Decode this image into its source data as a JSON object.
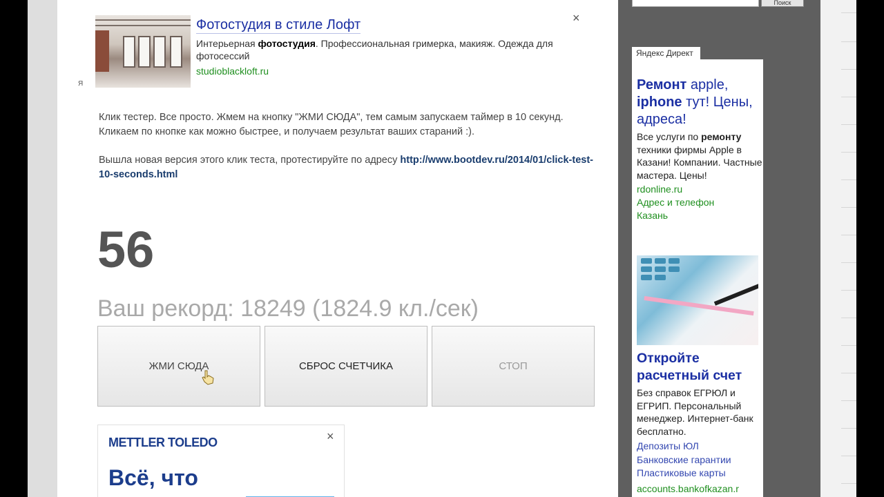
{
  "top_ad": {
    "title": "Фотостудия в стиле Лофт",
    "desc_prefix": "Интерьерная ",
    "desc_bold": "фотостудия",
    "desc_suffix": ". Профессиональная гримерка, макияж. Одежда для фотосессий",
    "domain": "studioblackloft.ru",
    "close": "×",
    "mark": "Я"
  },
  "description": {
    "p1": "Клик тестер. Все просто. Жмем на кнопку \"ЖМИ СЮДА\", тем самым запускаем таймер в 10 секунд. Кликаем по кнопке как можно быстрее, и получаем результат ваших стараний :).",
    "p2_prefix": "Вышла новая версия этого клик теста, протестируйте по адресу ",
    "p2_link": "http://www.bootdev.ru/2014/01/click-test-10-seconds.html"
  },
  "counter": "56",
  "record": "Ваш рекорд: 18249 (1824.9 кл./сек)",
  "buttons": {
    "click": "ЖМИ СЮДА",
    "reset": "СБРОС СЧЕТЧИКА",
    "stop": "СТОП"
  },
  "bottom_ad": {
    "logo": "METTLER TOLEDO",
    "slogan": "Всё, что",
    "close": "×"
  },
  "sidebar": {
    "search_button": "Поиск",
    "direct_label": "Яндекс Директ",
    "ad1": {
      "title_bold": "Ремонт",
      "title_rest1": " apple,",
      "title_bold2": "iphone",
      "title_rest2": " тут! Цены, адреса!",
      "text_prefix": "Все услуги по ",
      "text_bold": "ремонту",
      "text_suffix": " техники фирмы Apple в Казани! Компании. Частные мастера. Цены!",
      "domain": "rdonline.ru",
      "extra": "Адрес и телефон Казань"
    },
    "ad2": {
      "title": "Откройте расчетный счет",
      "text": "Без справок ЕГРЮЛ и ЕГРИП. Персональный менеджер. Интернет-банк бесплатно.",
      "links": [
        "Депозиты ЮЛ",
        "Банковские гарантии",
        "Пластиковые карты"
      ],
      "domain": "accounts.bankofkazan.r"
    }
  }
}
